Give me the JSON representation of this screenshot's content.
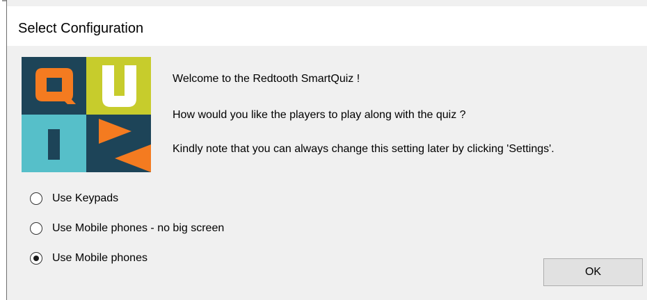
{
  "window": {
    "title": "Select Configuration"
  },
  "logo": {
    "letters": "QUIZ",
    "colors": {
      "orange": "#f47b20",
      "navy": "#1d4458",
      "lime": "#c7cc2c",
      "teal": "#56bfc9",
      "white": "#ffffff"
    }
  },
  "messages": {
    "welcome": "Welcome to the Redtooth SmartQuiz !",
    "question": "How would you like the players to play along with the quiz ?",
    "note": "Kindly note that you can always change this setting later by clicking 'Settings'."
  },
  "options": [
    {
      "label": "Use Keypads",
      "checked": false
    },
    {
      "label": "Use Mobile phones - no big screen",
      "checked": false
    },
    {
      "label": "Use Mobile phones",
      "checked": true
    }
  ],
  "buttons": {
    "ok_label": "OK"
  }
}
